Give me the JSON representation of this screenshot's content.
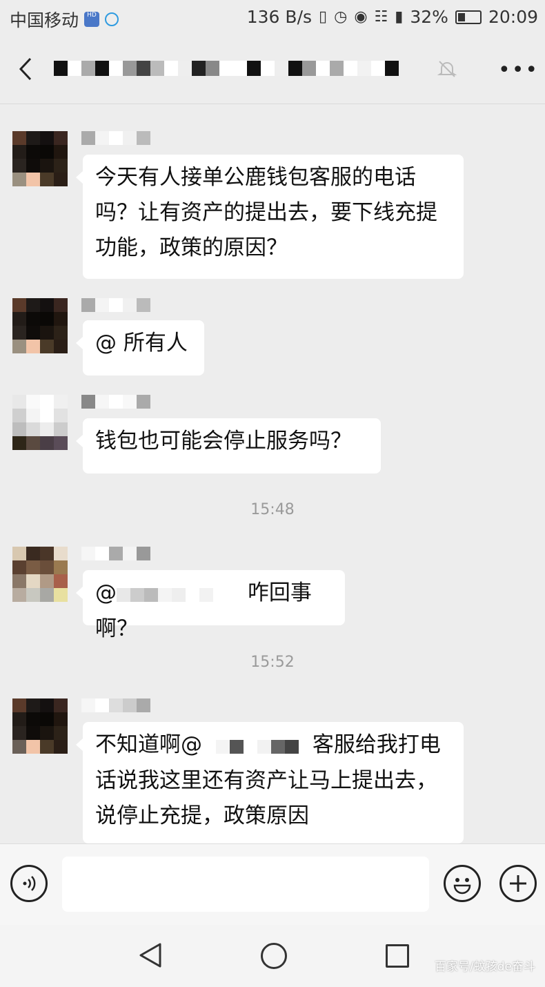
{
  "status_bar": {
    "carrier": "中国移动",
    "net_speed": "136 B/s",
    "battery": "32%",
    "time": "20:09"
  },
  "chat": {
    "messages": [
      {
        "text": "今天有人接单公鹿钱包客服的电话吗？让有资产的提出去，要下线充提功能，政策的原因？"
      },
      {
        "text": "@ 所有人"
      },
      {
        "text": "钱包也可能会停止服务吗？"
      },
      {
        "timestamp": "15:48"
      },
      {
        "text_prefix": "@",
        "text": "咋回事啊？"
      },
      {
        "timestamp": "15:52"
      },
      {
        "text_prefix": "不知道啊@",
        "text": "客服给我打电话说我这里还有资产让马上提出去，说停止充提，政策原因"
      }
    ]
  },
  "footer": {
    "watermark": "百家号/蚊孩de奋斗"
  },
  "colors": {
    "background": "#ededed",
    "bubble": "#ffffff",
    "timestamp": "#9a9a9a"
  },
  "icons": [
    "back-icon",
    "mute-icon",
    "more-icon",
    "voice-icon",
    "emoji-icon",
    "plus-icon",
    "nav-back-icon",
    "nav-home-icon",
    "nav-recent-icon"
  ]
}
